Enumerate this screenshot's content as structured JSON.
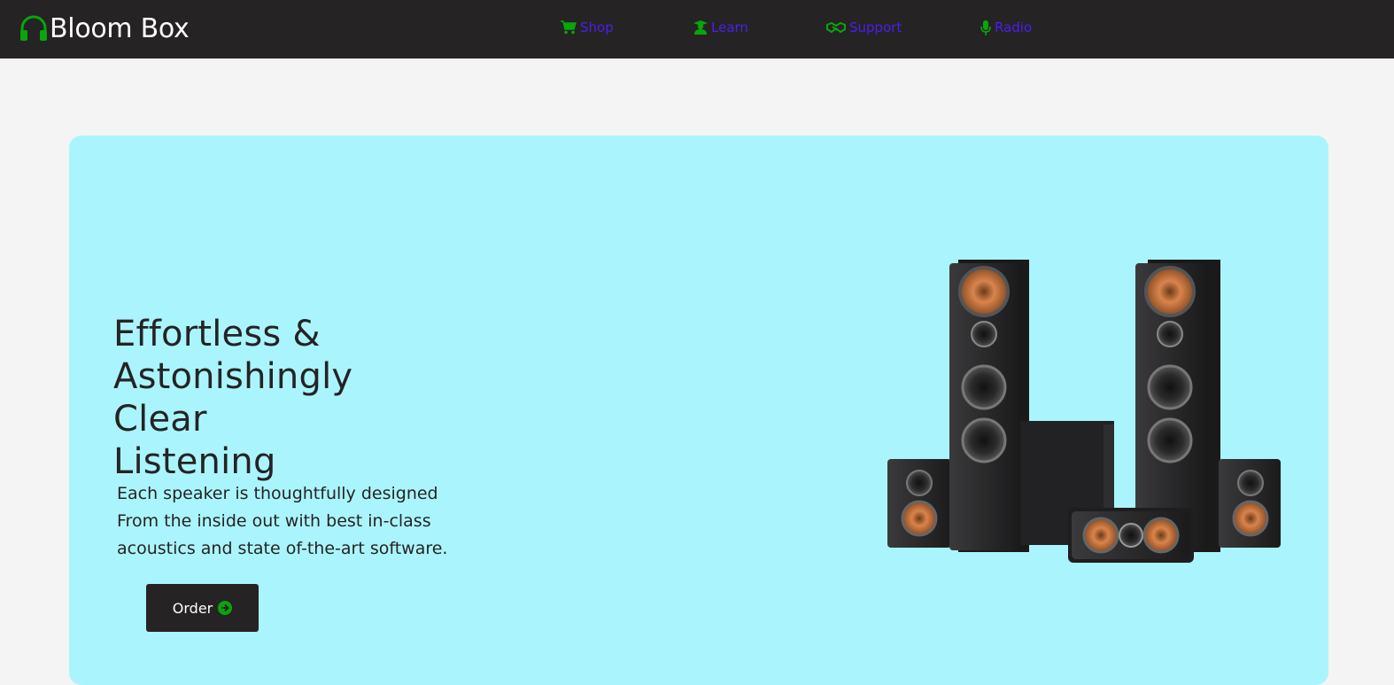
{
  "brand": {
    "name": "Bloom Box",
    "icon": "headphones-icon"
  },
  "nav": {
    "items": [
      {
        "label": "Shop",
        "icon": "cart-icon"
      },
      {
        "label": "Learn",
        "icon": "graduate-icon"
      },
      {
        "label": "Support",
        "icon": "handshake-icon"
      },
      {
        "label": "Radio",
        "icon": "microphone-icon"
      }
    ]
  },
  "hero": {
    "headline_lines": [
      "Effortless &",
      "Astonishingly",
      "Clear",
      "Listening"
    ],
    "subtext_lines": [
      "Each speaker is thoughtfully designed",
      "From the inside out with best in-class",
      "acoustics and state of-the-art software."
    ],
    "order_label": "Order",
    "order_icon": "arrow-circle-right-icon",
    "image": "speaker-set-image"
  },
  "colors": {
    "navbar_bg": "#252324",
    "accent_green": "#0aa50a",
    "nav_text": "#4a1ff0",
    "hero_bg": "#aaf5fd",
    "page_bg": "#f4f4f4",
    "text_dark": "#252324"
  }
}
